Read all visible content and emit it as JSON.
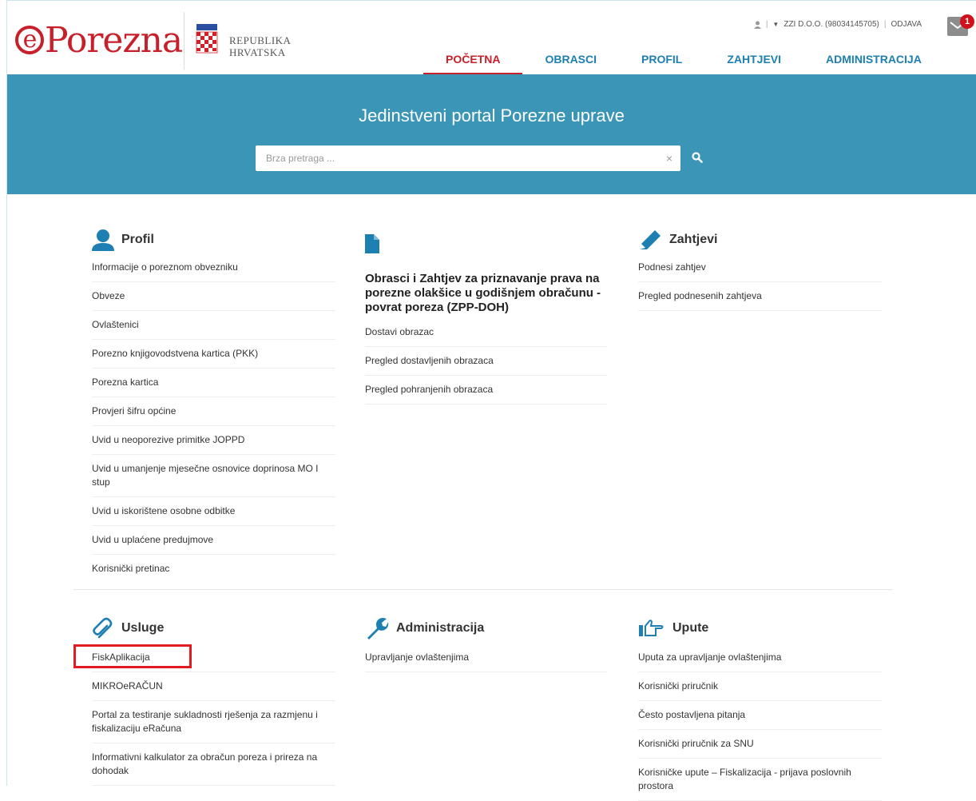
{
  "brand": {
    "logo_e": "e",
    "logo_rest": "Porezna",
    "republic_line1": "REPUBLIKA",
    "republic_line2": "HRVATSKA"
  },
  "user": {
    "company": "ZZI D.O.O. (98034145705)",
    "logout": "ODJAVA",
    "unread_count": "1"
  },
  "nav": {
    "items": [
      "POČETNA",
      "OBRASCI",
      "PROFIL",
      "ZAHTJEVI",
      "ADMINISTRACIJA"
    ],
    "active": "POČETNA"
  },
  "hero": {
    "title": "Jedinstveni portal Porezne uprave",
    "search_placeholder": "Brza pretraga ..."
  },
  "profil": {
    "title": "Profil",
    "items": [
      "Informacije o poreznom obvezniku",
      "Obveze",
      "Ovlaštenici",
      "Porezno knjigovodstvena kartica (PKK)",
      "Porezna kartica",
      "Provjeri šifru općine",
      "Uvid u neoporezive primitke JOPPD",
      "Uvid u umanjenje mjesečne osnovice doprinosa MO I stup",
      "Uvid u iskorištene osobne odbitke",
      "Uvid u uplaćene predujmove",
      "Korisnički pretinac"
    ]
  },
  "obrasci": {
    "heading": "Obrasci i Zahtjev za priznavanje prava na porezne olakšice u godišnjem obračunu - povrat poreza (ZPP-DOH)",
    "items": [
      "Dostavi obrazac",
      "Pregled dostavljenih obrazaca",
      "Pregled pohranjenih obrazaca"
    ]
  },
  "zahtjevi": {
    "title": "Zahtjevi",
    "items": [
      "Podnesi zahtjev",
      "Pregled podnesenih zahtjeva"
    ]
  },
  "usluge": {
    "title": "Usluge",
    "items": [
      "FiskAplikacija",
      "MIKROeRAČUN",
      "Portal za testiranje sukladnosti rješenja za razmjenu i fiskalizaciju eRačuna",
      "Informativni kalkulator za obračun poreza i prireza na dohodak"
    ]
  },
  "administracija": {
    "title": "Administracija",
    "items": [
      "Upravljanje ovlaštenjima"
    ]
  },
  "upute": {
    "title": "Upute",
    "items": [
      "Uputa za upravljanje ovlaštenjima",
      "Korisnički priručnik",
      "Često postavljena pitanja",
      "Korisnički priručnik za SNU",
      "Korisničke upute – Fiskalizacija - prijava poslovnih prostora"
    ]
  },
  "colors": {
    "brand_red": "#c8202a",
    "nav_blue": "#1d7fb2",
    "hero_blue": "#3a95b7",
    "highlight_red": "#e21b23"
  },
  "icons": {
    "profil": "user-icon",
    "obrasci": "document-icon",
    "zahtjevi": "pencil-icon",
    "usluge": "paperclip-icon",
    "administracija": "wrench-icon",
    "upute": "pointing-hand-icon"
  }
}
